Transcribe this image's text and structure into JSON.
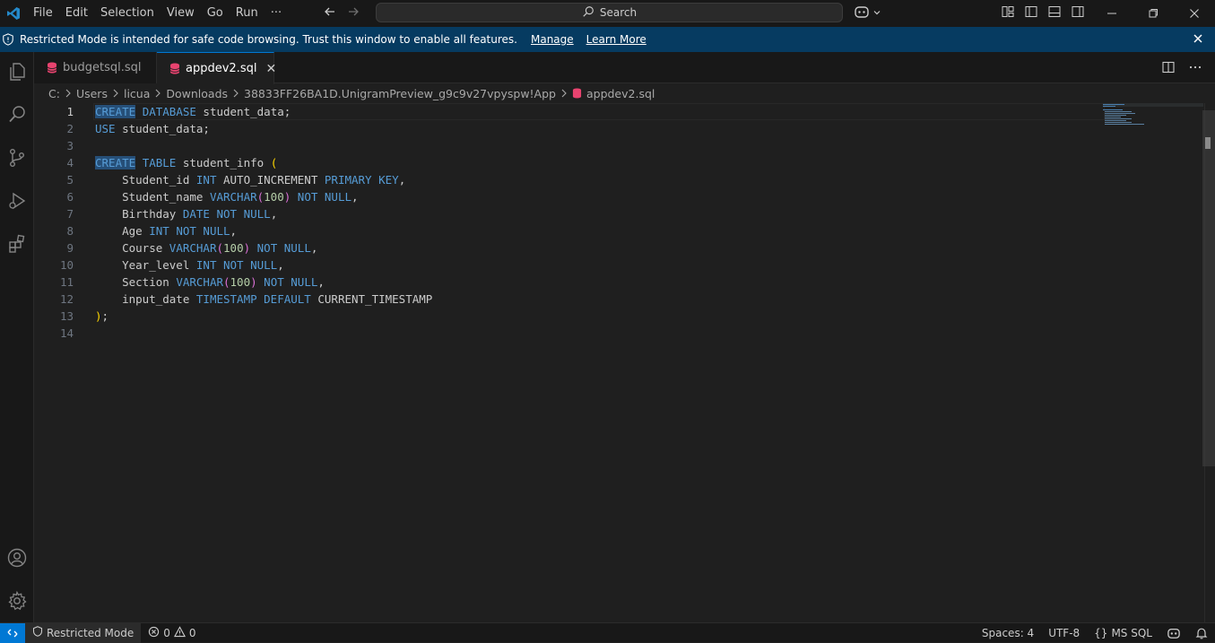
{
  "titlebar": {
    "menu": [
      "File",
      "Edit",
      "Selection",
      "View",
      "Go",
      "Run",
      "···"
    ],
    "search_label": "Search",
    "icons": [
      "vscode-logo-icon",
      "arrow-left-icon",
      "arrow-right-icon",
      "search-icon",
      "copilot-icon",
      "layout-icon",
      "sidebar-left-icon",
      "panel-icon",
      "sidebar-right-icon",
      "minimize-icon",
      "maximize-icon",
      "close-icon"
    ]
  },
  "banner": {
    "message": "Restricted Mode is intended for safe code browsing. Trust this window to enable all features.",
    "manage_label": "Manage",
    "learn_more_label": "Learn More"
  },
  "tabs": [
    {
      "label": "budgetsql.sql",
      "active": false
    },
    {
      "label": "appdev2.sql",
      "active": true,
      "close": "✕"
    }
  ],
  "breadcrumb": [
    "C:",
    "Users",
    "licua",
    "Downloads",
    "38833FF26BA1D.UnigramPreview_g9c9v27vpyspw!App",
    "appdev2.sql"
  ],
  "editor": {
    "line_numbers": [
      "1",
      "2",
      "3",
      "4",
      "5",
      "6",
      "7",
      "8",
      "9",
      "10",
      "11",
      "12",
      "13",
      "14"
    ],
    "current_line": 1
  },
  "statusbar": {
    "restricted_label": "Restricted Mode",
    "errors": "0",
    "warnings": "0",
    "spaces": "Spaces: 4",
    "encoding": "UTF-8",
    "language": "MS SQL"
  },
  "colors": {
    "accent": "#0078d4",
    "banner_bg": "#063b61",
    "keyword": "#569cd6",
    "number": "#b5cea8",
    "bracket": "#ffd700",
    "bracket_inner": "#da70d6",
    "editor_bg": "#1f1f1f"
  }
}
